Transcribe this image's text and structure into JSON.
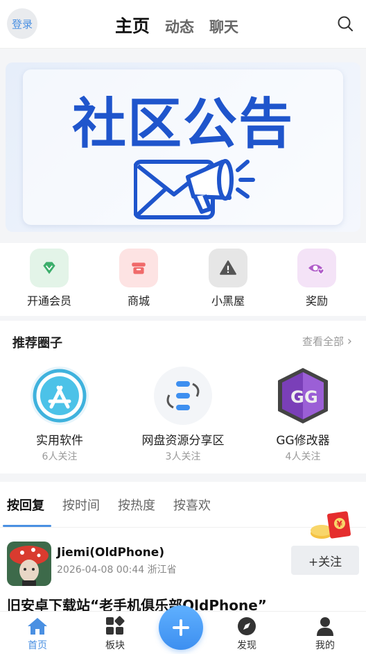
{
  "header": {
    "login_label": "登录",
    "tabs": [
      {
        "label": "主页",
        "active": true
      },
      {
        "label": "动态",
        "active": false
      },
      {
        "label": "聊天",
        "active": false
      }
    ],
    "search_icon": "search-icon"
  },
  "banner": {
    "title": "社区公告",
    "icon": "envelope-megaphone-icon",
    "accent_color": "#1f55cc"
  },
  "quick_actions": [
    {
      "label": "开通会员",
      "icon": "diamond-icon",
      "color": "#3cae6b",
      "bg": "#e3f4e8"
    },
    {
      "label": "商城",
      "icon": "store-icon",
      "color": "#f06a6a",
      "bg": "#fde3e3"
    },
    {
      "label": "小黑屋",
      "icon": "warning-icon",
      "color": "#555555",
      "bg": "#e6e6e6"
    },
    {
      "label": "奖励",
      "icon": "eye-heart-icon",
      "color": "#b05cc9",
      "bg": "#f4e3f7"
    }
  ],
  "recommended": {
    "title": "推荐圈子",
    "see_all": "查看全部",
    "items": [
      {
        "name": "实用软件",
        "followers": "6人关注",
        "icon": "app-store-icon"
      },
      {
        "name": "网盘资源分享区",
        "followers": "3人关注",
        "icon": "sync-share-icon"
      },
      {
        "name": "GG修改器",
        "followers": "4人关注",
        "icon": "gg-logo-icon"
      }
    ]
  },
  "sort_tabs": [
    {
      "label": "按回复",
      "active": true
    },
    {
      "label": "按时间",
      "active": false
    },
    {
      "label": "按热度",
      "active": false
    },
    {
      "label": "按喜欢",
      "active": false
    }
  ],
  "post": {
    "author": "Jiemi(OldPhone)",
    "meta": "2026-04-08 00:44 浙江省",
    "follow_label": "+关注",
    "title": "旧安卓下载站“老手机俱乐部OldPhone”",
    "reward_icon": "red-envelope-icon"
  },
  "bottom_nav": [
    {
      "label": "首页",
      "icon": "home-icon",
      "active": true
    },
    {
      "label": "板块",
      "icon": "blocks-icon",
      "active": false
    },
    {
      "label": "发现",
      "icon": "compass-icon",
      "active": false
    },
    {
      "label": "我的",
      "icon": "user-icon",
      "active": false
    }
  ],
  "fab_icon": "plus-icon",
  "colors": {
    "primary": "#4a90e2"
  }
}
